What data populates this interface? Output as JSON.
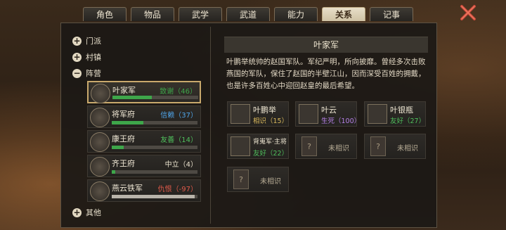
{
  "tabs": [
    "角色",
    "物品",
    "武学",
    "武道",
    "能力",
    "关系",
    "记事"
  ],
  "active_tab": "关系",
  "tree": {
    "sect": "门派",
    "town": "村镇",
    "camp": "阵营",
    "other": "其他"
  },
  "camps": [
    {
      "name": "叶家军",
      "relation": "致谢（46）",
      "level": 0.46,
      "color": "#3ea64a",
      "rel_color": "#3ea64a"
    },
    {
      "name": "将军府",
      "relation": "信赖（37）",
      "level": 0.37,
      "color": "#3ea64a",
      "rel_color": "#4fa4e8"
    },
    {
      "name": "康王府",
      "relation": "友善（14）",
      "level": 0.14,
      "color": "#3ea64a",
      "rel_color": "#4fbf5c"
    },
    {
      "name": "齐王府",
      "relation": "中立（4）",
      "level": 0.04,
      "color": "#3ea64a",
      "rel_color": "#e8e0cc"
    },
    {
      "name": "燕云铁军",
      "relation": "仇恨（-97）",
      "level": 0.97,
      "color": "#b9b4aa",
      "rel_color": "#e05a4a"
    }
  ],
  "detail": {
    "title": "叶家军",
    "description": "叶鹏举统帅的赵国军队。军纪严明，所向披靡。曾经多次击败燕国的军队，保住了赵国的半壁江山，因而深受百姓的拥戴，也是许多百姓心中迎回赵皇的最后希望。"
  },
  "members": [
    {
      "name": "叶鹏举",
      "relation": "相识（15）",
      "rel_color": "#d9b85c"
    },
    {
      "name": "叶云",
      "relation": "生死（100）",
      "rel_color": "#b580e6"
    },
    {
      "name": "叶银瓶",
      "relation": "友好（27）",
      "rel_color": "#4fbf5c"
    },
    {
      "name": "背嵬军·主将",
      "relation": "友好（22）",
      "rel_color": "#4fbf5c"
    }
  ],
  "unknown_label": "未相识",
  "unknown_glyph": "?"
}
